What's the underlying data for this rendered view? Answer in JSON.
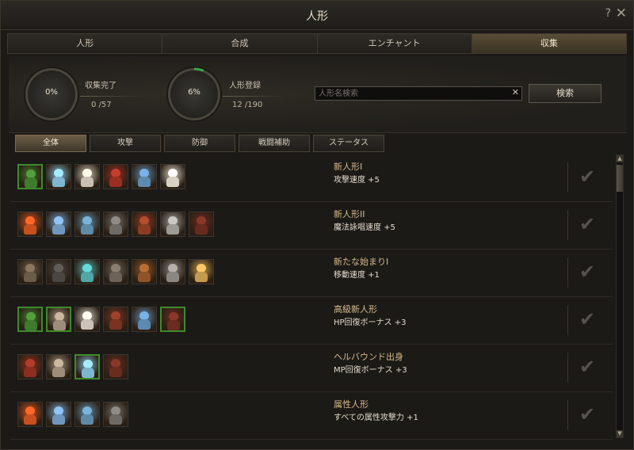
{
  "window": {
    "title": "人形",
    "help_label": "?",
    "close_label": "✕"
  },
  "tabs": [
    {
      "label": "人形"
    },
    {
      "label": "合成"
    },
    {
      "label": "エンチャント"
    },
    {
      "label": "収集",
      "active": true
    }
  ],
  "summary": {
    "complete": {
      "percent": "0%",
      "label": "収集完了",
      "count": "0 /57",
      "progress": 0
    },
    "registered": {
      "percent": "6%",
      "label": "人形登録",
      "count": "12 /190",
      "progress": 0.06
    }
  },
  "search": {
    "placeholder": "人形名検索",
    "value": "",
    "clear_label": "✕",
    "button_label": "検索"
  },
  "filters": [
    {
      "label": "全体",
      "active": true
    },
    {
      "label": "攻撃"
    },
    {
      "label": "防御"
    },
    {
      "label": "戦闘補助"
    },
    {
      "label": "ステータス"
    }
  ],
  "collections": [
    {
      "name": "新人形I",
      "bonus": "攻撃速度 +5",
      "dolls": [
        {
          "icon": "frog-doll",
          "color": "#3f7a2e",
          "owned": true
        },
        {
          "icon": "blue-spirit-doll",
          "color": "#7fb5cf",
          "owned": false
        },
        {
          "icon": "skeleton-doll",
          "color": "#c9c2b4",
          "owned": false
        },
        {
          "icon": "red-demon-doll",
          "color": "#9a2e22",
          "owned": false
        },
        {
          "icon": "ice-spirit-doll",
          "color": "#5d8ab0",
          "owned": false
        },
        {
          "icon": "white-ghost-doll",
          "color": "#d8d1c4",
          "owned": false
        }
      ]
    },
    {
      "name": "新人形II",
      "bonus": "魔法詠唱速度 +5",
      "dolls": [
        {
          "icon": "fire-spirit-doll",
          "color": "#c7501f",
          "owned": false
        },
        {
          "icon": "blue-giant-doll",
          "color": "#6f97bd",
          "owned": false
        },
        {
          "icon": "water-spirit-doll",
          "color": "#5e8aa8",
          "owned": false
        },
        {
          "icon": "golem-doll",
          "color": "#6e6b66",
          "owned": false
        },
        {
          "icon": "fire-beast-doll",
          "color": "#8b3b23",
          "owned": false
        },
        {
          "icon": "silver-knight-doll",
          "color": "#9d9a94",
          "owned": false
        },
        {
          "icon": "dark-lord-doll",
          "color": "#6b2a1e",
          "owned": false
        }
      ]
    },
    {
      "name": "新たな始まりI",
      "bonus": "移動速度 +1",
      "dolls": [
        {
          "icon": "armored-doll",
          "color": "#6a5c48",
          "owned": false
        },
        {
          "icon": "dark-wolf-doll",
          "color": "#4a4743",
          "owned": false
        },
        {
          "icon": "crystal-orb-doll",
          "color": "#4fa7a8",
          "owned": false
        },
        {
          "icon": "armored-knight-doll",
          "color": "#6c6257",
          "owned": false
        },
        {
          "icon": "tiger-doll",
          "color": "#8f5429",
          "owned": false
        },
        {
          "icon": "silver-lady-doll",
          "color": "#8c8781",
          "owned": false
        },
        {
          "icon": "golden-lion-doll",
          "color": "#c39a4e",
          "owned": false
        }
      ]
    },
    {
      "name": "高級新人形",
      "bonus": "HP回復ボーナス +3",
      "dolls": [
        {
          "icon": "frog-doll",
          "color": "#3f7a2e",
          "owned": true
        },
        {
          "icon": "skeleton-doll",
          "color": "#9d8d7a",
          "owned": true
        },
        {
          "icon": "white-ghost-doll",
          "color": "#c9c3ba",
          "owned": false
        },
        {
          "icon": "red-demon-doll",
          "color": "#7a3322",
          "owned": false
        },
        {
          "icon": "ice-spirit-doll",
          "color": "#5d8ab0",
          "owned": false
        },
        {
          "icon": "dark-demon-doll",
          "color": "#6a2c1f",
          "owned": true
        }
      ]
    },
    {
      "name": "ヘルバウンド出身",
      "bonus": "MP回復ボーナス +3",
      "dolls": [
        {
          "icon": "red-demon-doll",
          "color": "#8a2f20",
          "owned": false
        },
        {
          "icon": "skeleton-doll",
          "color": "#9d8d7a",
          "owned": false
        },
        {
          "icon": "blue-spirit-doll",
          "color": "#7fb5cf",
          "owned": true
        },
        {
          "icon": "dark-demon-doll",
          "color": "#6a2c1f",
          "owned": false
        }
      ]
    },
    {
      "name": "属性人形",
      "bonus": "すべての属性攻撃力 +1",
      "dolls": [
        {
          "icon": "fire-spirit-doll",
          "color": "#c7501f",
          "owned": false
        },
        {
          "icon": "blue-giant-doll",
          "color": "#6f97bd",
          "owned": false
        },
        {
          "icon": "water-spirit-doll",
          "color": "#5e8aa8",
          "owned": false
        },
        {
          "icon": "golem-doll",
          "color": "#6e6b66",
          "owned": false
        }
      ]
    }
  ],
  "icons": {
    "check": "checkmark-icon",
    "scroll_up": "scroll-up-arrow-icon",
    "scroll_down": "scroll-down-arrow-icon"
  },
  "colors": {
    "active_tab": "#5a4d36",
    "owned_border": "#3d8b2a",
    "gauge_progress": "#3fa34a",
    "collection_name": "#d6b98a"
  }
}
